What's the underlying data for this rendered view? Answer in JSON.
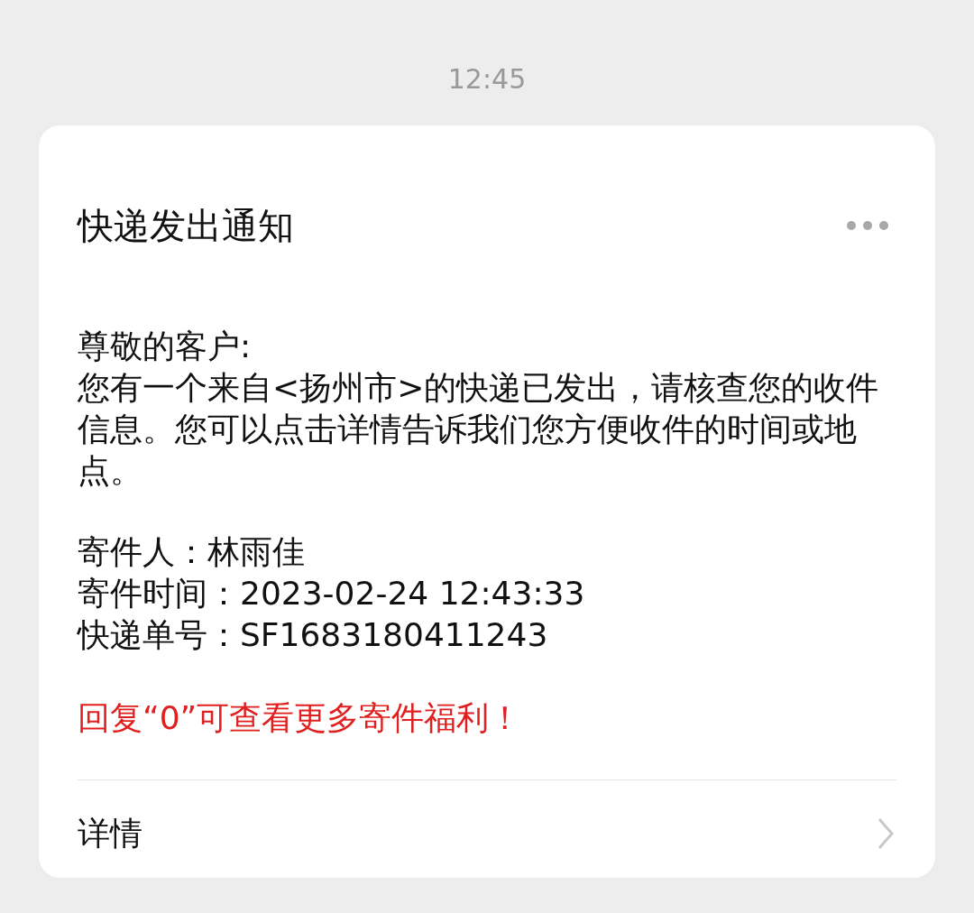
{
  "time": "12:45",
  "message": {
    "title": "快递发出通知",
    "greeting": "尊敬的客户:",
    "body": "您有一个来自<扬州市>的快递已发出，请核查您的收件信息。您可以点击详情告诉我们您方便收件的时间或地点。",
    "fields": [
      {
        "label": "寄件人：",
        "value": "林雨佳"
      },
      {
        "label": "寄件时间：",
        "value": "2023-02-24 12:43:33"
      },
      {
        "label": "快递单号：",
        "value": "SF1683180411243"
      }
    ],
    "promo": "回复“0”可查看更多寄件福利！",
    "link": "详情"
  }
}
